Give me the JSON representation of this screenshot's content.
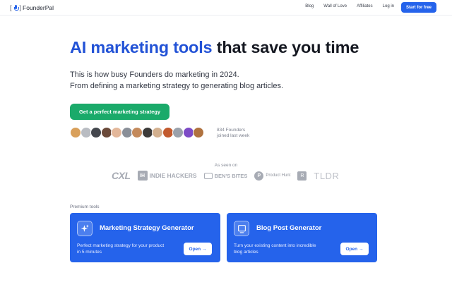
{
  "nav": {
    "logo_text": "FounderPal",
    "links": [
      "Blog",
      "Wall of Love",
      "Affiliates",
      "Log in"
    ],
    "cta_label": "Start for free"
  },
  "hero": {
    "title_accent": "AI marketing tools",
    "title_rest": "that save you time",
    "subtitle_line1": "This is how busy Founders do marketing in 2024.",
    "subtitle_line2": "From defining a marketing strategy to generating blog articles.",
    "cta_label": "Get a perfect marketing strategy",
    "founders_count": "834 Founders",
    "founders_note": "joined last week",
    "avatar_colors": [
      "#d9a05b",
      "#b9bcc2",
      "#44474d",
      "#6b4a3a",
      "#e3b79a",
      "#8a8f98",
      "#c48a5c",
      "#3d3b3a",
      "#d3b08f",
      "#c25a2e",
      "#9aa1ab",
      "#7d4bc6",
      "#b0723f"
    ]
  },
  "as_seen_on": {
    "label": "As seen on",
    "logos": {
      "cxl": "CXL",
      "indie_hackers_mark": "IH",
      "indie_hackers": "INDIE HACKERS",
      "bens_bites": "BEN'S BITES",
      "product_hunt_mark": "P",
      "product_hunt": "Product Hunt",
      "r_mark": "R",
      "tldr": "TLDR"
    }
  },
  "premium": {
    "label": "Premium tools",
    "cards": [
      {
        "title": "Marketing Strategy Generator",
        "desc": "Perfect marketing strategy for your product in 5 minutes",
        "button": "Open →"
      },
      {
        "title": "Blog Post Generator",
        "desc": "Turn your existing content into incredible blog articles",
        "button": "Open →"
      }
    ]
  },
  "colors": {
    "brand_blue": "#2563eb",
    "cta_green": "#1aaa6a"
  }
}
